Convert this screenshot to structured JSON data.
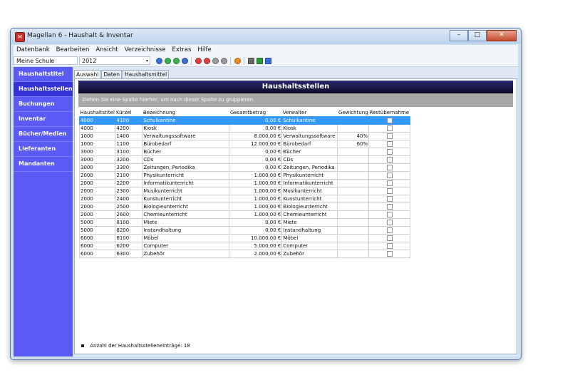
{
  "window": {
    "title": "Magellan 6 - Haushalt & Inventar",
    "app_icon_glyph": "M"
  },
  "window_controls": {
    "minimize": "–",
    "maximize": "□",
    "close": "✕"
  },
  "menu": [
    {
      "label": "Datenbank"
    },
    {
      "label": "Bearbeiten"
    },
    {
      "label": "Ansicht"
    },
    {
      "label": "Verzeichnisse"
    },
    {
      "label": "Extras"
    },
    {
      "label": "Hilfe"
    }
  ],
  "toolbar": {
    "school": "Meine Schule",
    "year": "2012",
    "arrow": "▾",
    "icons": [
      {
        "name": "nav-first-icon",
        "color": "#3a6fd8"
      },
      {
        "name": "nav-prev-icon",
        "color": "#3ab04a"
      },
      {
        "name": "nav-next-icon",
        "color": "#3ab04a"
      },
      {
        "name": "nav-last-icon",
        "color": "#3a6fd8"
      },
      {
        "name": "add-record-icon",
        "color": "#e04040"
      },
      {
        "name": "delete-record-icon",
        "color": "#e04040"
      },
      {
        "name": "save-record-icon",
        "color": "#9a9a9a"
      },
      {
        "name": "cancel-record-icon",
        "color": "#9a9a9a"
      },
      {
        "name": "refresh-icon",
        "color": "#f08a1a"
      },
      {
        "name": "print-icon",
        "color": "#6b6b6b"
      },
      {
        "name": "export-excel-icon",
        "color": "#2e9a3a"
      },
      {
        "name": "export-document-icon",
        "color": "#3a6fd8"
      }
    ]
  },
  "sidebar": {
    "items": [
      {
        "label": "Haushaltstitel",
        "active": false
      },
      {
        "label": "Haushaltsstellen",
        "active": true
      },
      {
        "label": "Buchungen",
        "active": false
      },
      {
        "label": "Inventar",
        "active": false
      },
      {
        "label": "Bücher/Medien",
        "active": false
      },
      {
        "label": "Lieferanten",
        "active": false
      },
      {
        "label": "Mandanten",
        "active": false
      }
    ]
  },
  "tabs": [
    {
      "label": "Auswahl",
      "active": true
    },
    {
      "label": "Daten",
      "active": false
    },
    {
      "label": "Haushaltsmittel",
      "active": false
    }
  ],
  "panel": {
    "title": "Haushaltsstellen",
    "group_hint": "Ziehen Sie eine Spalte hierher, um nach dieser Spalte zu gruppieren"
  },
  "table": {
    "columns": [
      "Haushaltstitel",
      "Kürzel",
      "Bezeichnung",
      "Gesamtbetrag",
      "Verwalter",
      "Gewichtung",
      "Restübernahme"
    ],
    "rows": [
      {
        "titel": "4000",
        "kuerzel": "4100",
        "bezeichnung": "Schulkantine",
        "betrag": "0,00 €",
        "verwalter": "Schulkantine",
        "gewichtung": "",
        "selected": true
      },
      {
        "titel": "4000",
        "kuerzel": "4200",
        "bezeichnung": "Kiosk",
        "betrag": "0,00 €",
        "verwalter": "Kiosk",
        "gewichtung": ""
      },
      {
        "titel": "1000",
        "kuerzel": "1400",
        "bezeichnung": "Verwaltungssoftware",
        "betrag": "8.000,00 €",
        "verwalter": "Verwaltungssoftware",
        "gewichtung": "40%"
      },
      {
        "titel": "1000",
        "kuerzel": "1100",
        "bezeichnung": "Bürobedarf",
        "betrag": "12.000,00 €",
        "verwalter": "Bürobedarf",
        "gewichtung": "60%"
      },
      {
        "titel": "3000",
        "kuerzel": "3100",
        "bezeichnung": "Bücher",
        "betrag": "0,00 €",
        "verwalter": "Bücher",
        "gewichtung": ""
      },
      {
        "titel": "3000",
        "kuerzel": "3200",
        "bezeichnung": "CDs",
        "betrag": "0,00 €",
        "verwalter": "CDs",
        "gewichtung": ""
      },
      {
        "titel": "3000",
        "kuerzel": "3300",
        "bezeichnung": "Zeitungen, Periodika",
        "betrag": "0,00 €",
        "verwalter": "Zeitungen, Periodika",
        "gewichtung": ""
      },
      {
        "titel": "2000",
        "kuerzel": "2100",
        "bezeichnung": "Physikunterricht",
        "betrag": "1.000,00 €",
        "verwalter": "Physikunterricht",
        "gewichtung": ""
      },
      {
        "titel": "2000",
        "kuerzel": "2200",
        "bezeichnung": "Informatikunterricht",
        "betrag": "1.000,00 €",
        "verwalter": "Informatikunterricht",
        "gewichtung": ""
      },
      {
        "titel": "2000",
        "kuerzel": "2300",
        "bezeichnung": "Musikunterricht",
        "betrag": "1.000,00 €",
        "verwalter": "Musikunterricht",
        "gewichtung": ""
      },
      {
        "titel": "2000",
        "kuerzel": "2400",
        "bezeichnung": "Kunstunterricht",
        "betrag": "1.000,00 €",
        "verwalter": "Kunstunterricht",
        "gewichtung": ""
      },
      {
        "titel": "2000",
        "kuerzel": "2500",
        "bezeichnung": "Biologieunterricht",
        "betrag": "1.000,00 €",
        "verwalter": "Biologieunterricht",
        "gewichtung": ""
      },
      {
        "titel": "2000",
        "kuerzel": "2600",
        "bezeichnung": "Chemieunterricht",
        "betrag": "1.000,00 €",
        "verwalter": "Chemieunterricht",
        "gewichtung": ""
      },
      {
        "titel": "5000",
        "kuerzel": "8100",
        "bezeichnung": "Miete",
        "betrag": "0,00 €",
        "verwalter": "Miete",
        "gewichtung": ""
      },
      {
        "titel": "5000",
        "kuerzel": "8200",
        "bezeichnung": "Instandhaltung",
        "betrag": "0,00 €",
        "verwalter": "Instandhaltung",
        "gewichtung": ""
      },
      {
        "titel": "6000",
        "kuerzel": "6100",
        "bezeichnung": "Möbel",
        "betrag": "10.000,00 €",
        "verwalter": "Möbel",
        "gewichtung": ""
      },
      {
        "titel": "6000",
        "kuerzel": "6200",
        "bezeichnung": "Computer",
        "betrag": "5.000,00 €",
        "verwalter": "Computer",
        "gewichtung": ""
      },
      {
        "titel": "6000",
        "kuerzel": "6300",
        "bezeichnung": "Zubehör",
        "betrag": "2.000,00 €",
        "verwalter": "Zubehör",
        "gewichtung": ""
      }
    ]
  },
  "status": {
    "text": "Anzahl der Haushaltsstelleneinträge: 18"
  },
  "colors": {
    "sidebar": "#5a5af5",
    "sidebar_active": "#3333d6",
    "selection": "#3399ff",
    "header": "#0a0a28"
  }
}
